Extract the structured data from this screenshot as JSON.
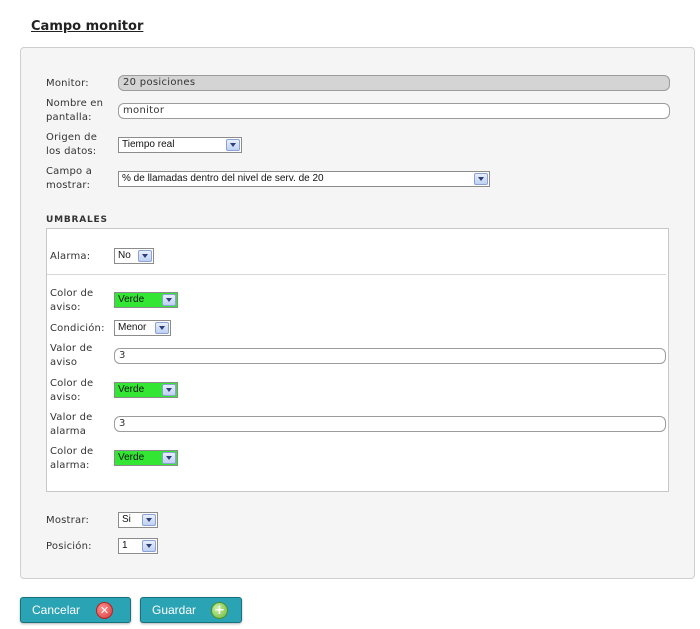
{
  "page": {
    "title": "Campo monitor"
  },
  "form": {
    "monitor": {
      "label": "Monitor:",
      "value": "20 posiciones"
    },
    "nombre": {
      "label_1": "Nombre en",
      "label_2": "pantalla:",
      "value": "monitor"
    },
    "origen": {
      "label_1": "Origen de",
      "label_2": "los datos:",
      "value": "Tiempo real"
    },
    "campo": {
      "label_1": "Campo a",
      "label_2": "mostrar:",
      "value": "% de llamadas dentro del nivel de serv. de 20"
    }
  },
  "umbrales": {
    "title": "UMBRALES",
    "alarma": {
      "label": "Alarma:",
      "value": "No"
    },
    "color_aviso_1": {
      "label_1": "Color de",
      "label_2": "aviso:",
      "value": "Verde",
      "color": "#33e633"
    },
    "condicion": {
      "label": "Condición:",
      "value": "Menor"
    },
    "valor_aviso": {
      "label_1": "Valor de",
      "label_2": "aviso",
      "value": "3"
    },
    "color_aviso_2": {
      "label_1": "Color de",
      "label_2": "aviso:",
      "value": "Verde",
      "color": "#33e633"
    },
    "valor_alarma": {
      "label_1": "Valor de",
      "label_2": "alarma",
      "value": "3"
    },
    "color_alarma": {
      "label_1": "Color de",
      "label_2": "alarma:",
      "value": "Verde",
      "color": "#33e633"
    }
  },
  "bottom": {
    "mostrar": {
      "label": "Mostrar:",
      "value": "Si"
    },
    "posicion": {
      "label": "Posición:",
      "value": "1"
    }
  },
  "buttons": {
    "cancel": {
      "label": "Cancelar",
      "icon": "close-circle-icon"
    },
    "save": {
      "label": "Guardar",
      "icon": "plus-circle-icon"
    }
  }
}
